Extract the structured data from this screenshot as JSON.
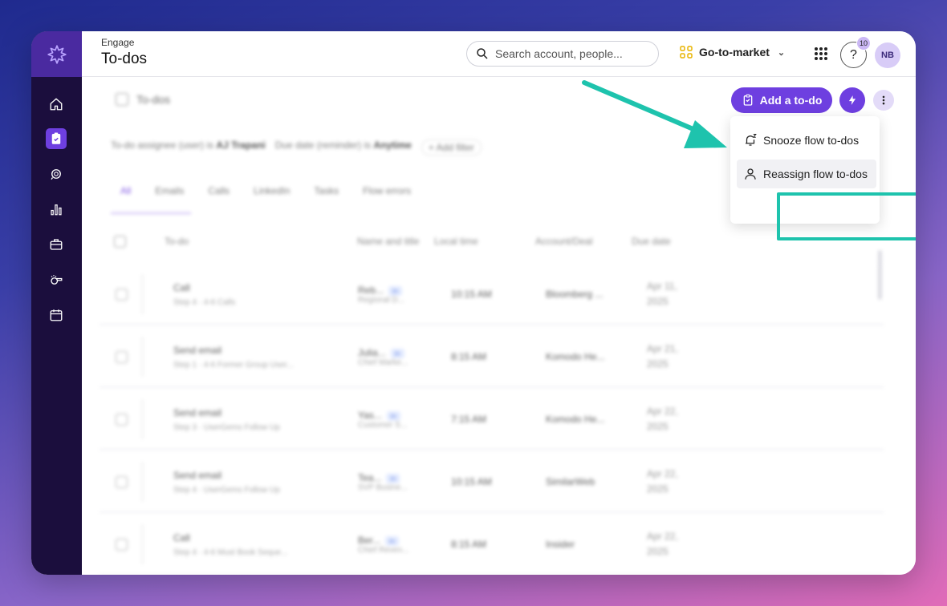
{
  "header": {
    "breadcrumb": "Engage",
    "title": "To-dos",
    "search_placeholder": "Search account, people...",
    "workspace": "Go-to-market",
    "help_label": "?",
    "help_badge": "10",
    "avatar_initials": "NB"
  },
  "sidebar": {
    "items": [
      {
        "name": "home-icon"
      },
      {
        "name": "clipboard-icon",
        "active": true
      },
      {
        "name": "conversations-icon"
      },
      {
        "name": "analytics-icon"
      },
      {
        "name": "briefcase-icon"
      },
      {
        "name": "whistle-icon"
      },
      {
        "name": "calendar-icon"
      }
    ]
  },
  "toolbar": {
    "section_title": "To-dos",
    "add_button": "Add a to-do"
  },
  "filters": {
    "assignee": "To-do assignee (user) is",
    "assignee_value": "AJ Trapani",
    "due_date": "Due date (reminder) is",
    "due_date_value": "Anytime",
    "add_filter": "+ Add filter"
  },
  "tabs": [
    "All",
    "Emails",
    "Calls",
    "LinkedIn",
    "Tasks",
    "Flow errors"
  ],
  "table": {
    "columns": [
      "To-do",
      "Name and title",
      "Local time",
      "Account/Deal",
      "Due date"
    ],
    "rows": [
      {
        "type": "Call",
        "step": "Step 4 · 4-6 Calls",
        "name": "Reb...",
        "title": "Regional D...",
        "time": "10:15 AM",
        "account": "Bloomberg ...",
        "due1": "Apr 11,",
        "due2": "2025"
      },
      {
        "type": "Send email",
        "step": "Step 1 · 4-6 Former Group User...",
        "name": "Julia...",
        "title": "Chief Marke...",
        "time": "8:15 AM",
        "account": "Komodo He...",
        "due1": "Apr 21,",
        "due2": "2025"
      },
      {
        "type": "Send email",
        "step": "Step 3 · UserGems Follow Up",
        "name": "Yas...",
        "title": "Customer S...",
        "time": "7:15 AM",
        "account": "Komodo He...",
        "due1": "Apr 22,",
        "due2": "2025"
      },
      {
        "type": "Send email",
        "step": "Step 4 · UserGems Follow Up",
        "name": "Tea...",
        "title": "SVP Busine...",
        "time": "10:15 AM",
        "account": "SimilarWeb",
        "due1": "Apr 22,",
        "due2": "2025"
      },
      {
        "type": "Call",
        "step": "Step 4 · 4-6 Must Book Seque...",
        "name": "Ber...",
        "title": "Chief Reven...",
        "time": "8:15 AM",
        "account": "Insider",
        "due1": "Apr 22,",
        "due2": "2025"
      }
    ]
  },
  "menu": {
    "items": [
      "Snooze flow to-dos",
      "Reassign flow to-dos"
    ]
  },
  "colors": {
    "accent": "#6e3fe0",
    "sidebar": "#1b0e3d",
    "highlight": "#1ec3ad"
  }
}
